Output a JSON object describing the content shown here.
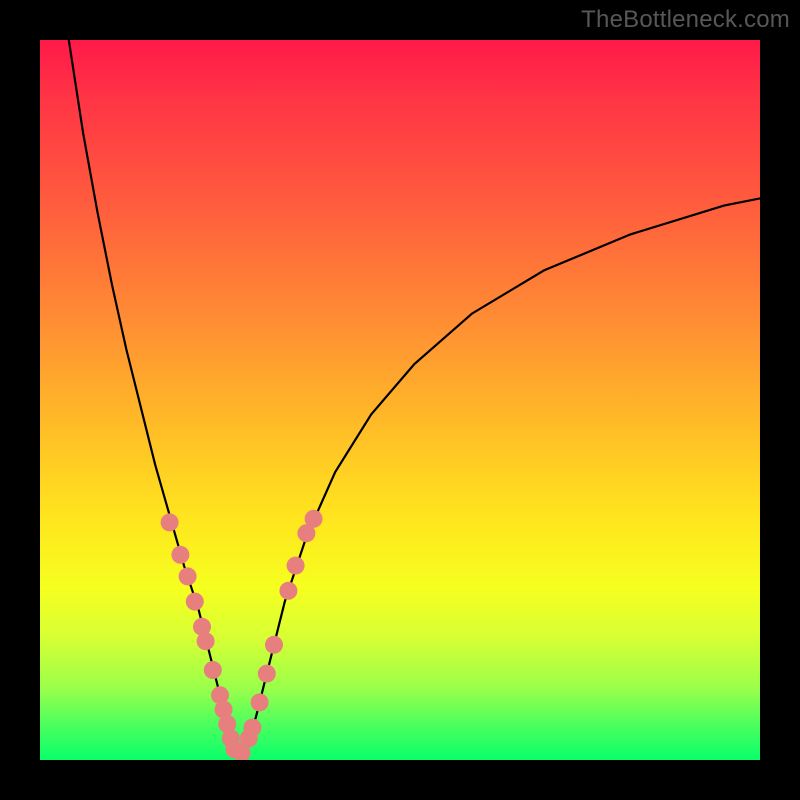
{
  "watermark": "TheBottleneck.com",
  "chart_data": {
    "type": "line",
    "title": "",
    "xlabel": "",
    "ylabel": "",
    "xlim": [
      0,
      100
    ],
    "ylim": [
      0,
      100
    ],
    "grid": false,
    "legend": false,
    "background_gradient": {
      "direction": "vertical",
      "stops": [
        {
          "pos": 0,
          "color": "#ff1a49"
        },
        {
          "pos": 22,
          "color": "#ff5a3e"
        },
        {
          "pos": 52,
          "color": "#ffb728"
        },
        {
          "pos": 76,
          "color": "#f6ff1f"
        },
        {
          "pos": 90,
          "color": "#9bff4a"
        },
        {
          "pos": 100,
          "color": "#09ff6a"
        }
      ]
    },
    "series": [
      {
        "name": "left-branch",
        "color": "#000000",
        "x": [
          4,
          6,
          8,
          10,
          12,
          14,
          16,
          18,
          20,
          22,
          23,
          24,
          25,
          26,
          27,
          28
        ],
        "y": [
          100,
          87,
          76,
          66,
          57,
          49,
          41,
          34,
          27,
          21,
          17,
          13,
          9,
          6,
          3,
          1
        ]
      },
      {
        "name": "right-branch",
        "color": "#000000",
        "x": [
          28,
          29,
          30,
          31,
          32,
          34,
          37,
          41,
          46,
          52,
          60,
          70,
          82,
          95,
          100
        ],
        "y": [
          1,
          3,
          6,
          10,
          14,
          22,
          31,
          40,
          48,
          55,
          62,
          68,
          73,
          77,
          78
        ]
      }
    ],
    "markers": {
      "name": "highlighted-points",
      "color": "#e77f7f",
      "radius_px": 9,
      "points": [
        {
          "x": 18.0,
          "y": 33.0
        },
        {
          "x": 19.5,
          "y": 28.5
        },
        {
          "x": 20.5,
          "y": 25.5
        },
        {
          "x": 21.5,
          "y": 22.0
        },
        {
          "x": 22.5,
          "y": 18.5
        },
        {
          "x": 23.0,
          "y": 16.5
        },
        {
          "x": 24.0,
          "y": 12.5
        },
        {
          "x": 25.0,
          "y": 9.0
        },
        {
          "x": 25.5,
          "y": 7.0
        },
        {
          "x": 26.0,
          "y": 5.0
        },
        {
          "x": 26.5,
          "y": 3.0
        },
        {
          "x": 27.0,
          "y": 1.5
        },
        {
          "x": 28.0,
          "y": 1.0
        },
        {
          "x": 29.0,
          "y": 3.0
        },
        {
          "x": 29.5,
          "y": 4.5
        },
        {
          "x": 30.5,
          "y": 8.0
        },
        {
          "x": 31.5,
          "y": 12.0
        },
        {
          "x": 32.5,
          "y": 16.0
        },
        {
          "x": 34.5,
          "y": 23.5
        },
        {
          "x": 35.5,
          "y": 27.0
        },
        {
          "x": 37.0,
          "y": 31.5
        },
        {
          "x": 38.0,
          "y": 33.5
        }
      ]
    }
  }
}
